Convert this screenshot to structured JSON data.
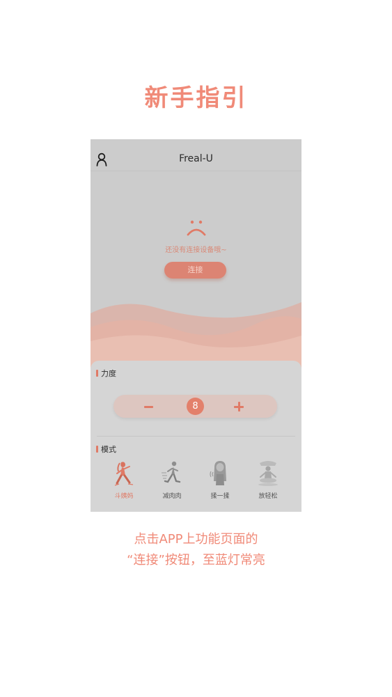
{
  "guide": {
    "title": "新手指引",
    "caption_line1": "点击APP上功能页面的",
    "caption_line2": "“连接”按钮，至蓝灯常亮"
  },
  "app": {
    "title": "Freal-U",
    "no_device_text": "还没有连接设备哦~",
    "connect_label": "连接",
    "strength": {
      "label": "力度",
      "value": "8"
    },
    "mode": {
      "label": "模式",
      "items": [
        {
          "label": "斗姨妈",
          "active": true
        },
        {
          "label": "减肉肉",
          "active": false
        },
        {
          "label": "揉一揉",
          "active": false
        },
        {
          "label": "放轻松",
          "active": false
        }
      ]
    }
  },
  "colors": {
    "accent": "#f08a78",
    "button": "#dc8473",
    "screen_bg": "#cccccc"
  }
}
